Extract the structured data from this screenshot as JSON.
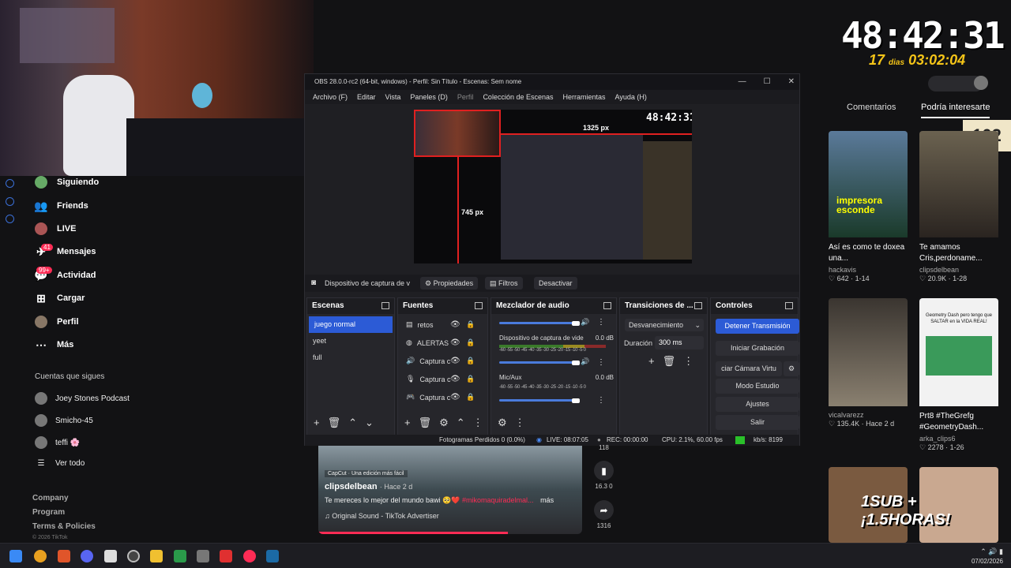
{
  "obs": {
    "title": "OBS 28.0.0-rc2 (64-bit, windows) - Perfil: Sin Título - Escenas: Sem nome",
    "menu": [
      "Archivo (F)",
      "Editar",
      "Vista",
      "Paneles (D)",
      "Perfil",
      "Colección de Escenas",
      "Herramientas",
      "Ayuda (H)"
    ],
    "preview": {
      "w_label": "1325 px",
      "h_label": "745 px",
      "clock": "48:42:31"
    },
    "source_bar": {
      "label": "Dispositivo de captura de v",
      "properties": "Propiedades",
      "filters": "Filtros",
      "deactivate": "Desactivar"
    },
    "docks": {
      "scenes": {
        "title": "Escenas",
        "items": [
          "juego normal",
          "yeet",
          "full"
        ]
      },
      "sources": {
        "title": "Fuentes",
        "items": [
          "retos",
          "ALERTAS",
          "Captura c",
          "Captura c",
          "Captura c"
        ]
      },
      "mixer": {
        "title": "Mezclador de audio",
        "ch1_label": "Dispositivo de captura de vide",
        "ch1_db": "0.0 dB",
        "ch2_label": "Mic/Aux",
        "ch2_db": "0.0 dB",
        "scale": "-60 -55 -50 -45 -40 -35 -30 -25 -20 -15 -10 -5 0"
      },
      "transitions": {
        "title": "Transiciones de ...",
        "type": "Desvanecimiento",
        "duration_label": "Duración",
        "duration": "300 ms"
      },
      "controls": {
        "title": "Controles",
        "buttons": [
          "Detener Transmisión",
          "Iniciar Grabación",
          "ciar Cámara Virtu",
          "Modo Estudio",
          "Ajustes",
          "Salir"
        ]
      }
    },
    "status": {
      "dropped": "Fotogramas Perdidos 0 (0.0%)",
      "live": "LIVE: 08:07:05",
      "rec": "REC: 00:00:00",
      "cpu": "CPU: 2.1%, 60.00 fps",
      "kbs": "kb/s: 8199"
    }
  },
  "overlay": {
    "clock": "48:42:31",
    "days_num": "17",
    "days_label": "dias",
    "days_time": "03:02:04",
    "sub_badge": "102"
  },
  "sidebar": {
    "nav": [
      {
        "label": "Siguiendo",
        "icon": "avatar-icon"
      },
      {
        "label": "Friends",
        "icon": "friends-icon"
      },
      {
        "label": "LIVE",
        "icon": "live-icon"
      },
      {
        "label": "Mensajes",
        "icon": "messages-icon",
        "badge": "41"
      },
      {
        "label": "Actividad",
        "icon": "activity-icon",
        "badge": "99+"
      },
      {
        "label": "Cargar",
        "icon": "upload-icon"
      },
      {
        "label": "Perfil",
        "icon": "profile-icon"
      },
      {
        "label": "Más",
        "icon": "more-icon"
      }
    ],
    "following_title": "Cuentas que sigues",
    "following": [
      "Joey Stones Podcast",
      "Smicho-45",
      "teffi 🌸"
    ],
    "see_all": "Ver todo",
    "footer": [
      "Company",
      "Program",
      "Terms & Policies",
      "© 2026 TikTok"
    ]
  },
  "right": {
    "tabs": [
      "Comentarios",
      "Podría interesarte"
    ],
    "cards": [
      {
        "title": "Así es como te doxea una...",
        "user": "hackavis",
        "stats": "♡ 642 · 1-14",
        "thumb_text": "impresora esconde"
      },
      {
        "title": "Te amamos Cris,perdoname...",
        "user": "clipsdelbean",
        "stats": "♡ 20.9K · 1-28",
        "thumb_text": ""
      },
      {
        "title": "",
        "user": "vicalvarezz",
        "stats": "♡ 135.4K · Hace 2 d",
        "thumb_text": ""
      },
      {
        "title": "Prt8 #TheGrefg #GeometryDash...",
        "user": "arka_clips6",
        "stats": "♡ 2278 · 1-26",
        "thumb_text": "Geometry Dash pero tengo que SALTAR en la VIDA REAL!"
      }
    ],
    "overlay_text": "1SUB + ¡1.5HORAS!"
  },
  "video": {
    "app_label": "CapCut · Una edición más fácil",
    "user": "clipsdelbean",
    "time": "· Hace 2 d",
    "caption": "Te mereces lo mejor del mundo bawi 🥺❤️",
    "hashtag": "#mikomaquiradelmal...",
    "more": "más",
    "sound": "♫ Original Sound - TikTok Advertiser",
    "side": [
      {
        "icon": "♥",
        "count": "118"
      },
      {
        "icon": "🔖",
        "count": "16.3 0"
      },
      {
        "icon": "➦",
        "count": "1316"
      }
    ]
  },
  "taskbar": {
    "date": "07/02/2026"
  }
}
